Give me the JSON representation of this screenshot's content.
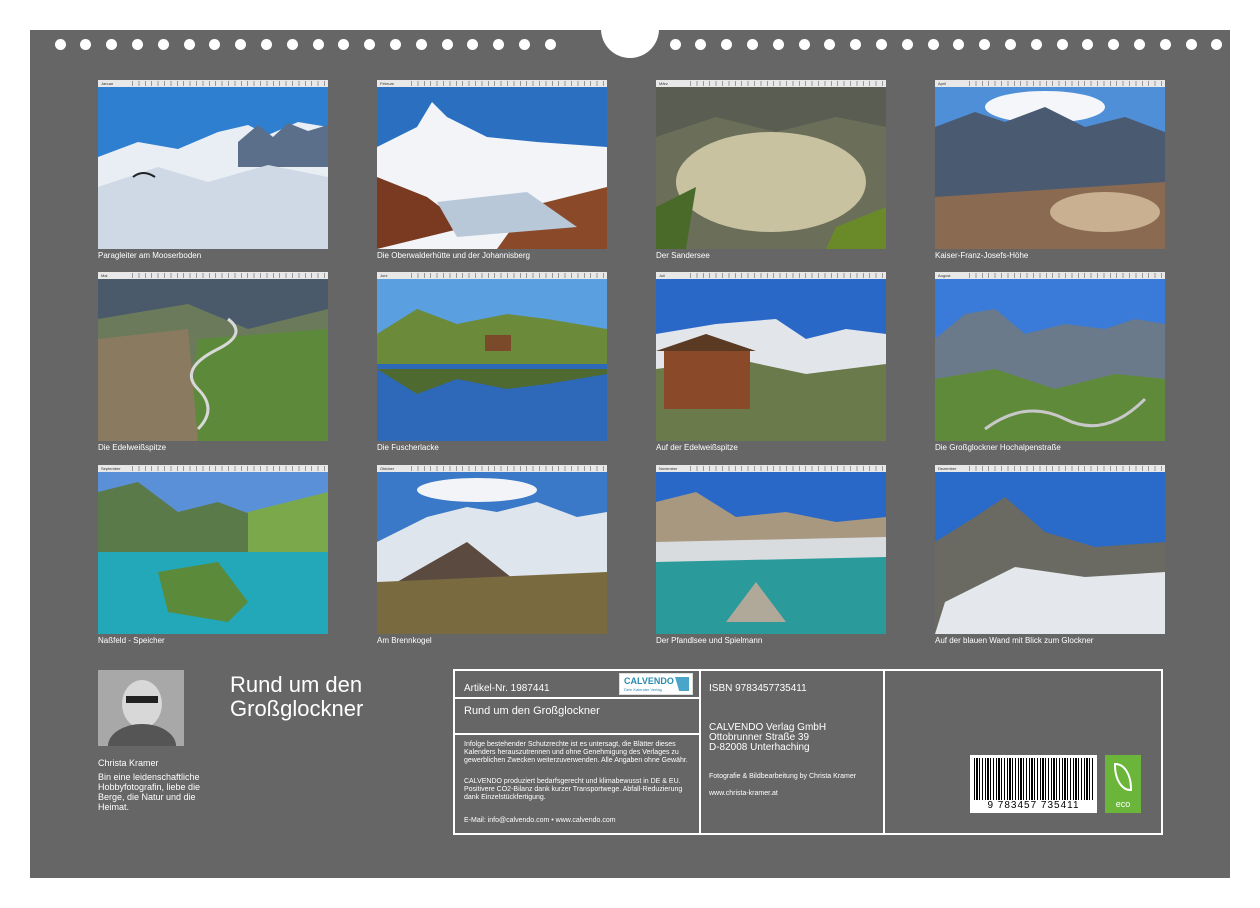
{
  "tiles": [
    {
      "month_label": "Januar",
      "caption": "Paragleiter am Mooserboden"
    },
    {
      "month_label": "Februar",
      "caption": "Die Oberwalderhütte und der Johannisberg"
    },
    {
      "month_label": "März",
      "caption": "Der Sandersee"
    },
    {
      "month_label": "April",
      "caption": "Kaiser-Franz-Josefs-Höhe"
    },
    {
      "month_label": "Mai",
      "caption": "Die Edelweißspitze"
    },
    {
      "month_label": "Juni",
      "caption": "Die Fuscherlacke"
    },
    {
      "month_label": "Juli",
      "caption": "Auf der Edelweißspitze"
    },
    {
      "month_label": "August",
      "caption": "Die Großglockner Hochalpenstraße"
    },
    {
      "month_label": "September",
      "caption": "Naßfeld - Speicher"
    },
    {
      "month_label": "Oktober",
      "caption": "Am Brennkogel"
    },
    {
      "month_label": "November",
      "caption": "Der Pfandlsee und Spielmann"
    },
    {
      "month_label": "Dezember",
      "caption": "Auf der blauen Wand mit Blick zum Glockner"
    }
  ],
  "author": {
    "name": "Christa Kramer",
    "bio": "Bin eine leidenschaftliche Hobbyfotografin, liebe die Berge, die Natur und die Heimat."
  },
  "calendar_title": "Rund um den Großglockner",
  "info": {
    "article_no": "Artikel-Nr. 1987441",
    "calvendo_logo": "CALVENDO",
    "calvendo_sub": "Dein Kalender Verlag",
    "product_title": "Rund um den Großglockner",
    "legal_text": "Infolge bestehender Schutzrechte ist es untersagt, die Blätter dieses Kalenders herauszutrennen und ohne Genehmigung des Verlages zu gewerblichen Zwecken weiterzuverwenden. Alle Angaben ohne Gewähr.",
    "eco_text": "CALVENDO produziert bedarfsgerecht und klimabewusst in DE & EU. Positivere CO2-Bilanz dank kurzer Transportwege. Abfall-Reduzierung dank Einzelstückfertigung.",
    "contact": "E-Mail: info@calvendo.com • www.calvendo.com",
    "isbn": "ISBN 9783457735411",
    "publisher_name": "CALVENDO Verlag GmbH",
    "publisher_street": "Ottobrunner Straße 39",
    "publisher_city": "D-82008 Unterhaching",
    "photo_credit": "Fotografie & Bildbearbeitung by Christa Kramer",
    "photo_url": "www.christa-kramer.at",
    "barcode_number": "9 783457 735411",
    "eco_label": "eco"
  },
  "colors": {
    "background": "#666666",
    "border": "#ffffff",
    "text": "#ffffff",
    "eco_green": "#6bb53b",
    "calvendo_blue": "#2a8ab0"
  }
}
